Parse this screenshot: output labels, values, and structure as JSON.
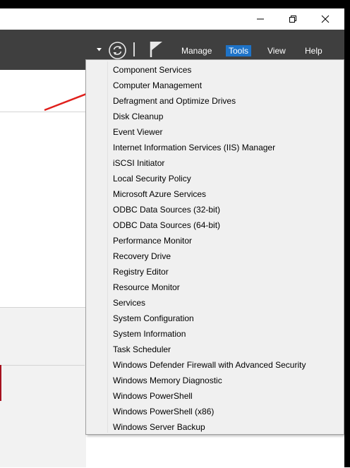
{
  "window": {
    "controls": [
      "minimize",
      "restore",
      "close"
    ]
  },
  "header": {
    "menu": {
      "manage": "Manage",
      "tools": "Tools",
      "view": "View",
      "help": "Help"
    },
    "active_menu": "Tools",
    "icons": [
      "dropdown-arrow-icon",
      "refresh-icon",
      "flag-icon"
    ]
  },
  "tools_menu": {
    "items": [
      "Component Services",
      "Computer Management",
      "Defragment and Optimize Drives",
      "Disk Cleanup",
      "Event Viewer",
      "Internet Information Services (IIS) Manager",
      "iSCSI Initiator",
      "Local Security Policy",
      "Microsoft Azure Services",
      "ODBC Data Sources (32-bit)",
      "ODBC Data Sources (64-bit)",
      "Performance Monitor",
      "Recovery Drive",
      "Registry Editor",
      "Resource Monitor",
      "Services",
      "System Configuration",
      "System Information",
      "Task Scheduler",
      "Windows Defender Firewall with Advanced Security",
      "Windows Memory Diagnostic",
      "Windows PowerShell",
      "Windows PowerShell (x86)",
      "Windows Server Backup"
    ],
    "highlighted_by_arrow": "Computer Management"
  },
  "colors": {
    "header_bg": "#3f3f3f",
    "active_menu_bg": "#1e73c8",
    "annotation_arrow": "#e0201c",
    "menu_bg": "#f0f0f0"
  }
}
